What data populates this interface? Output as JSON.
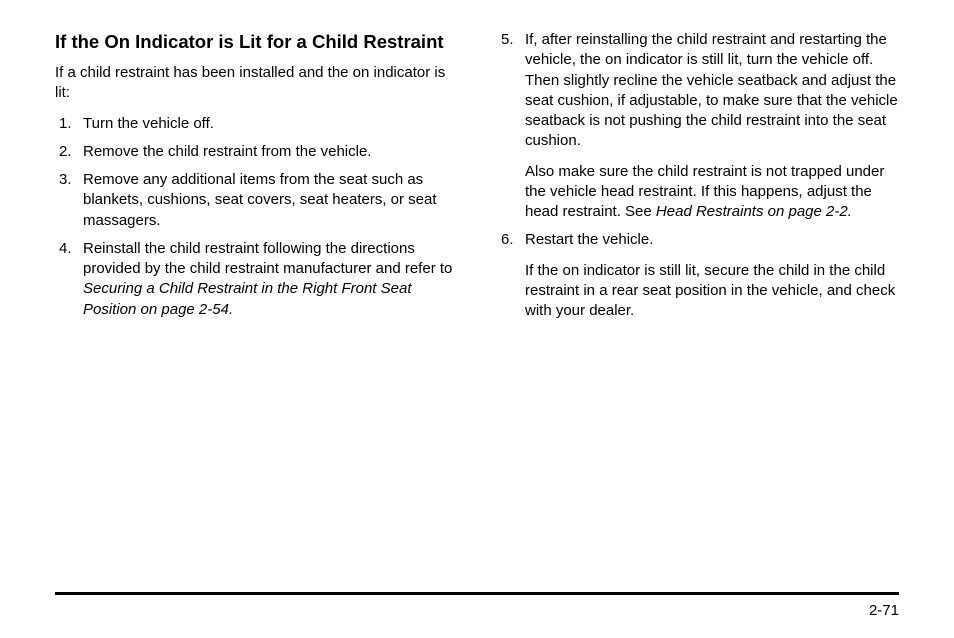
{
  "heading": "If the On Indicator is Lit for a Child Restraint",
  "intro": "If a child restraint has been installed and the on indicator is lit:",
  "list": {
    "n1": "1.",
    "i1": "Turn the vehicle off.",
    "n2": "2.",
    "i2": "Remove the child restraint from the vehicle.",
    "n3": "3.",
    "i3": "Remove any additional items from the seat such as blankets, cushions, seat covers, seat heaters, or seat massagers.",
    "n4": "4.",
    "i4a": "Reinstall the child restraint following the directions provided by the child restraint manufacturer and refer to ",
    "i4b_ital": "Securing a Child Restraint in the Right Front Seat Position on page 2‑54.",
    "n5": "5.",
    "i5": "If, after reinstalling the child restraint and restarting the vehicle, the on indicator is still lit, turn the vehicle off. Then slightly recline the vehicle seatback and adjust the seat cushion, if adjustable, to make sure that the vehicle seatback is not pushing the child restraint into the seat cushion.",
    "i5_cont_a": "Also make sure the child restraint is not trapped under the vehicle head restraint. If this happens, adjust the head restraint. See ",
    "i5_cont_b_ital": "Head Restraints on page 2‑2.",
    "n6": "6.",
    "i6": "Restart the vehicle.",
    "i6_cont": "If the on indicator is still lit, secure the child in the child restraint in a rear seat position in the vehicle, and check with your dealer."
  },
  "page_number": "2-71"
}
